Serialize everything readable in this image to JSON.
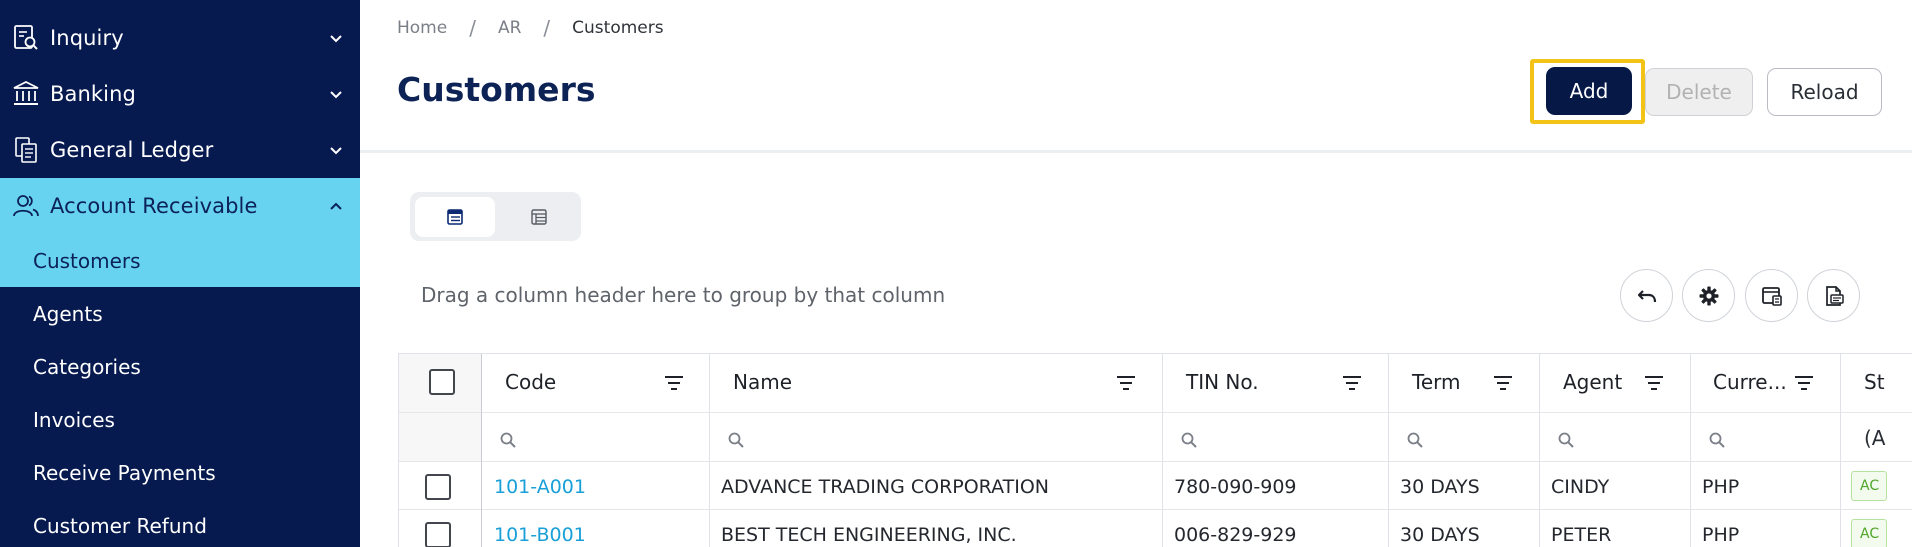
{
  "sidebar": {
    "groups": [
      {
        "label": "Inquiry",
        "icon": "search-document-icon",
        "expanded": false
      },
      {
        "label": "Banking",
        "icon": "bank-icon",
        "expanded": false
      },
      {
        "label": "General Ledger",
        "icon": "ledger-icon",
        "expanded": false
      },
      {
        "label": "Account Receivable",
        "icon": "users-icon",
        "expanded": true
      }
    ],
    "sub_items": [
      "Customers",
      "Agents",
      "Categories",
      "Invoices",
      "Receive Payments",
      "Customer Refund"
    ],
    "active_sub": "Customers"
  },
  "breadcrumb": [
    "Home",
    "AR",
    "Customers"
  ],
  "page_title": "Customers",
  "actions": {
    "add": "Add",
    "delete": "Delete",
    "reload": "Reload"
  },
  "group_hint": "Drag a column header here to group by that column",
  "grid": {
    "columns": [
      "Code",
      "Name",
      "TIN No.",
      "Term",
      "Agent",
      "Curre...",
      "St"
    ],
    "status_filter_text": "(A",
    "rows": [
      {
        "code": "101-A001",
        "name": "ADVANCE TRADING CORPORATION",
        "tin": "780-090-909",
        "term": "30 DAYS",
        "agent": "CINDY",
        "currency": "PHP",
        "status": "AC"
      },
      {
        "code": "101-B001",
        "name": "BEST TECH ENGINEERING, INC.",
        "tin": "006-829-929",
        "term": "30 DAYS",
        "agent": "PETER",
        "currency": "PHP",
        "status": "AC"
      }
    ]
  },
  "colors": {
    "sidebar_bg": "#071a4f",
    "sidebar_active": "#67d3f0",
    "primary_button": "#061846",
    "focus_ring": "#f3c318",
    "link": "#19a0d8"
  }
}
